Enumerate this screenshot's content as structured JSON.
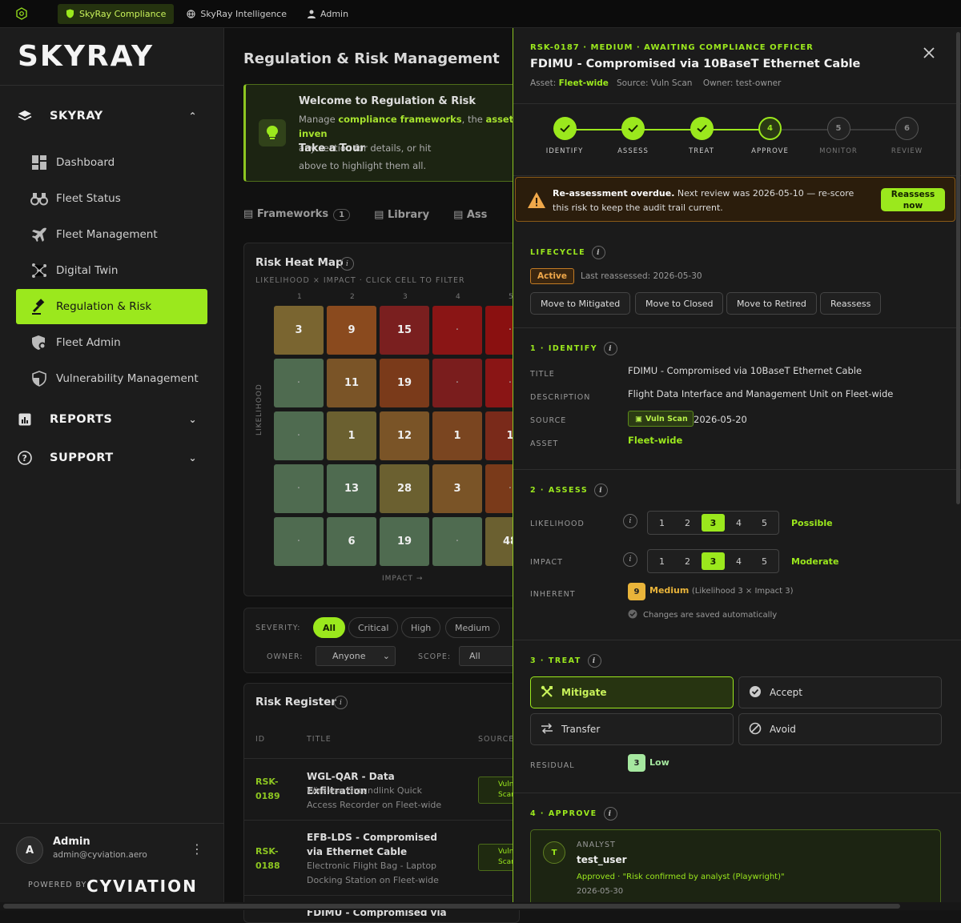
{
  "topbar": {
    "tabs": [
      {
        "label": "SkyRay Compliance",
        "active": true
      },
      {
        "label": "SkyRay Intelligence",
        "active": false
      },
      {
        "label": "Admin",
        "active": false
      }
    ]
  },
  "sidebar": {
    "brand": "SKYRAY",
    "group_skyray": "SKYRAY",
    "items": [
      {
        "label": "Dashboard",
        "icon": "dashboard-icon"
      },
      {
        "label": "Fleet Status",
        "icon": "binoculars-icon"
      },
      {
        "label": "Fleet Management",
        "icon": "plane-icon"
      },
      {
        "label": "Digital Twin",
        "icon": "network-icon"
      },
      {
        "label": "Regulation & Risk",
        "icon": "gavel-icon",
        "active": true
      },
      {
        "label": "Fleet Admin",
        "icon": "shield-gear-icon"
      },
      {
        "label": "Vulnerability Management",
        "icon": "shield-icon"
      }
    ],
    "group_reports": "REPORTS",
    "group_support": "SUPPORT",
    "user": {
      "initial": "A",
      "name": "Admin",
      "email": "admin@cyviation.aero"
    },
    "powered_by": "POWERED BY",
    "powered_brand": "CYVIATION"
  },
  "main": {
    "title": "Regulation & Risk Management",
    "welcome": {
      "title": "Welcome to Regulation & Risk",
      "body_prefix": "Manage ",
      "body_link1": "compliance frameworks",
      "body_mid": ", the ",
      "body_link2": "asset inven",
      "body_line2": "any section for details, or hit",
      "tour": "Take a Tour",
      "body_line3": "above to highlight them all."
    },
    "tabs": [
      {
        "label": "Frameworks",
        "badge": "1"
      },
      {
        "label": "Library"
      },
      {
        "label": "Ass"
      }
    ],
    "heatmap": {
      "title": "Risk Heat Map",
      "subtitle": "LIKELIHOOD × IMPACT · CLICK CELL TO FILTER",
      "columns": [
        "1",
        "2",
        "3",
        "4",
        "5"
      ],
      "y_label": "LIKELIHOOD",
      "x_label": "IMPACT →",
      "rows": [
        [
          "3",
          "9",
          "15",
          "·",
          "·"
        ],
        [
          "·",
          "11",
          "19",
          "·",
          "·"
        ],
        [
          "·",
          "1",
          "12",
          "1",
          "1"
        ],
        [
          "·",
          "13",
          "28",
          "3",
          "·"
        ],
        [
          "·",
          "6",
          "19",
          "·",
          "48"
        ]
      ]
    },
    "filters": {
      "severity_label": "SEVERITY:",
      "severity": [
        "All",
        "Critical",
        "High",
        "Medium"
      ],
      "owner_label": "OWNER:",
      "owner_value": "Anyone",
      "scope_label": "SCOPE:",
      "scope_value": "All"
    },
    "register": {
      "title": "Risk Register",
      "headers": [
        "ID",
        "TITLE",
        "SOURCE"
      ],
      "rows": [
        {
          "id": "RSK-0189",
          "title": "WGL-QAR - Data Exfiltration",
          "desc": "Wireless Groundlink Quick Access Recorder on Fleet-wide",
          "source": "Vuln Scan"
        },
        {
          "id": "RSK-0188",
          "title": "EFB-LDS - Compromised via Ethernet Cable",
          "desc": "Electronic Flight Bag - Laptop Docking Station on Fleet-wide",
          "source": "Vuln Scan"
        },
        {
          "id": "",
          "title": "FDIMU - Compromised via",
          "desc": "",
          "source": ""
        }
      ]
    }
  },
  "drawer": {
    "tag": "RSK-0187 · MEDIUM · AWAITING COMPLIANCE OFFICER",
    "title": "FDIMU - Compromised via 10BaseT Ethernet Cable",
    "meta": {
      "asset_label": "Asset:",
      "asset": "Fleet-wide",
      "source": "Source: Vuln Scan",
      "owner": "Owner: test-owner"
    },
    "steps": [
      {
        "n": "1",
        "label": "IDENTIFY",
        "state": "done"
      },
      {
        "n": "2",
        "label": "ASSESS",
        "state": "done"
      },
      {
        "n": "3",
        "label": "TREAT",
        "state": "done"
      },
      {
        "n": "4",
        "label": "APPROVE",
        "state": "current"
      },
      {
        "n": "5",
        "label": "MONITOR",
        "state": "todo"
      },
      {
        "n": "6",
        "label": "REVIEW",
        "state": "todo"
      }
    ],
    "alert": {
      "bold": "Re-assessment overdue.",
      "text": " Next review was 2026-05-10 — re-score this risk to keep the audit trail current.",
      "button_line1": "Reassess",
      "button_line2": "now"
    },
    "lifecycle": {
      "heading": "LIFECYCLE",
      "status": "Active",
      "reassessed": "Last reassessed: 2026-05-30",
      "actions": [
        "Move to Mitigated",
        "Move to Closed",
        "Move to Retired",
        "Reassess"
      ]
    },
    "identify": {
      "heading": "1 · IDENTIFY",
      "title_label": "TITLE",
      "title": "FDIMU - Compromised via 10BaseT Ethernet Cable",
      "desc_label": "DESCRIPTION",
      "desc": "Flight Data Interface and Management Unit on Fleet-wide",
      "source_label": "SOURCE",
      "source_chip": "Vuln Scan",
      "source_date": "2026-05-20",
      "asset_label": "ASSET",
      "asset": "Fleet-wide"
    },
    "assess": {
      "heading": "2 · ASSESS",
      "likelihood_label": "LIKELIHOOD",
      "likelihood_options": [
        "1",
        "2",
        "3",
        "4",
        "5"
      ],
      "likelihood_value": 3,
      "likelihood_text": "Possible",
      "impact_label": "IMPACT",
      "impact_options": [
        "1",
        "2",
        "3",
        "4",
        "5"
      ],
      "impact_value": 3,
      "impact_text": "Moderate",
      "inherent_label": "INHERENT",
      "inherent_score": "9",
      "inherent_level": "Medium",
      "inherent_detail": "(Likelihood 3 × Impact 3)",
      "autosave": "Changes are saved automatically"
    },
    "treat": {
      "heading": "3 · TREAT",
      "options": [
        "Mitigate",
        "Accept",
        "Transfer",
        "Avoid"
      ],
      "selected": "Mitigate",
      "residual_label": "RESIDUAL",
      "residual_score": "3",
      "residual_level": "Low"
    },
    "approve": {
      "heading": "4 · APPROVE",
      "avatar": "T",
      "role": "ANALYST",
      "user": "test_user",
      "status": "Approved · \"Risk confirmed by analyst (Playwright)\"",
      "date": "2026-05-30"
    }
  },
  "colors": {
    "accent": "#9be81d",
    "warning": "#f0a84a",
    "medium": "#e9b43a",
    "low": "#a6e8a0"
  }
}
